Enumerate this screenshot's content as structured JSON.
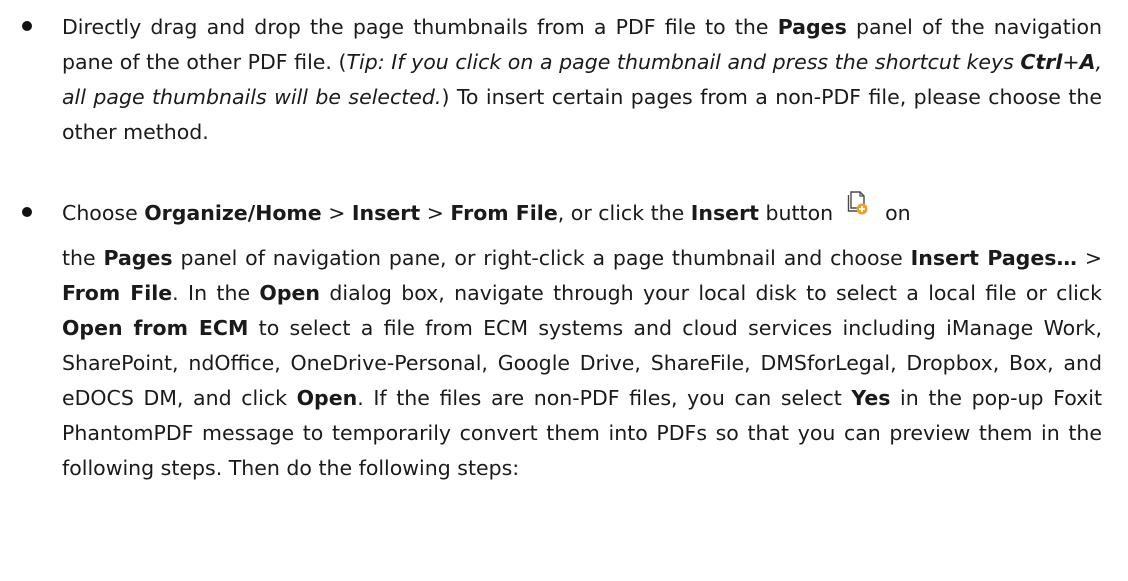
{
  "bullet1": {
    "t1": "Directly drag and drop the page thumbnails from a PDF file to the ",
    "t2": "Pages",
    "t3": " panel of the navigation pane of the other PDF file. (",
    "t4": "Tip: If you click on a page thumbnail and press the shortcut keys ",
    "t5": "Ctrl",
    "t6": "+",
    "t7": "A",
    "t8": ", all page thumbnails will be selected.",
    "t9": ") To insert certain pages from a non-PDF file, please choose the other method."
  },
  "bullet2": {
    "s1": "Choose ",
    "s2": "Organize/Home",
    "s3": " > ",
    "s4": "Insert",
    "s5": " > ",
    "s6": "From File",
    "s7": ", or click the ",
    "s8": "Insert",
    "s9": " button",
    "s10": "on",
    "s11": "the ",
    "s12": "Pages",
    "s13": " panel of navigation pane, or right-click a page thumbnail and choose ",
    "s14": "Insert Pages…",
    "s15": " > ",
    "s16": "From File",
    "s17": ". In the ",
    "s18": "Open",
    "s19": " dialog box, navigate through your local disk to select a local file or click ",
    "s20": "Open from ECM",
    "s21": " to select a file from ECM systems and cloud services including iManage Work, SharePoint, ndOffice, OneDrive-Personal, Google Drive, ShareFile, DMSforLegal, Dropbox, Box, and eDOCS DM, and click ",
    "s22": "Open",
    "s23": ". If the files are non-PDF files, you can select ",
    "s24": "Yes",
    "s25": " in the pop-up Foxit PhantomPDF message to temporarily convert them into PDFs so that you can preview them in the following steps. Then do the following steps:"
  },
  "icons": {
    "insert_icon": "insert-pages-icon",
    "bullet": "bullet-dot"
  },
  "colors": {
    "text": "#1a1a1a",
    "icon_page": "#4a4a4a",
    "icon_badge": "#f0a020"
  }
}
